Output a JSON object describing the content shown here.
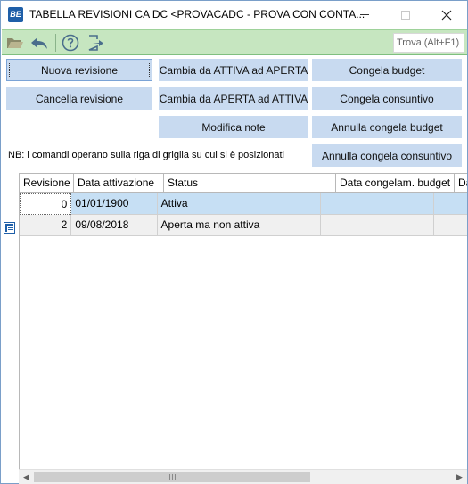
{
  "window": {
    "title": "TABELLA REVISIONI CA DC <PROVACADC - PROVA CON CONTA...",
    "app_icon_text": "BE"
  },
  "toolbar": {
    "icons": [
      "folder-open-icon",
      "undo-icon",
      "help-icon",
      "exit-icon"
    ],
    "search_placeholder": "Trova (Alt+F1)"
  },
  "buttons": {
    "nuova_revisione": "Nuova revisione",
    "cancella_revisione": "Cancella revisione",
    "cambia_attiva_aperta": "Cambia da ATTIVA ad APERTA",
    "cambia_aperta_attiva": "Cambia da APERTA ad ATTIVA",
    "modifica_note": "Modifica note",
    "congela_budget": "Congela budget",
    "congela_consuntivo": "Congela consuntivo",
    "annulla_congela_budget": "Annulla congela budget",
    "annulla_congela_consuntivo": "Annulla congela consuntivo"
  },
  "note": "NB: i comandi operano sulla riga di griglia su cui si è posizionati",
  "grid": {
    "columns": [
      "Revisione",
      "Data attivazione",
      "Status",
      "Data congelam. budget",
      "Da"
    ],
    "rows": [
      {
        "revisione": "0",
        "data_attivazione": "01/01/1900",
        "status": "Attiva",
        "data_congelam_budget": "",
        "extra": ""
      },
      {
        "revisione": "2",
        "data_attivazione": "09/08/2018",
        "status": "Aperta ma non attiva",
        "data_congelam_budget": "",
        "extra": ""
      }
    ]
  },
  "colors": {
    "toolbar_bg": "#c6e6c0",
    "button_bg": "#c8daf0",
    "selected_row": "#c6dff4"
  }
}
